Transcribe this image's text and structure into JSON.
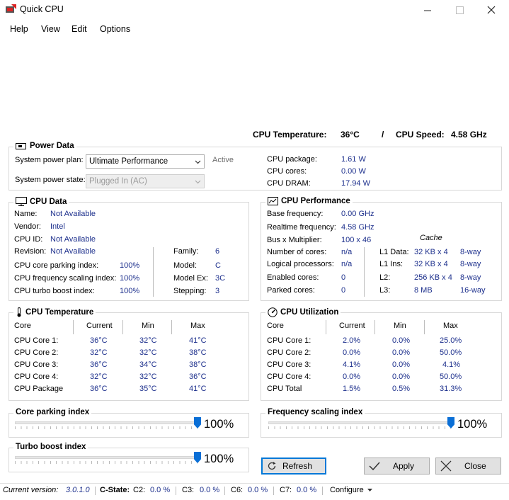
{
  "window": {
    "title": "Quick CPU"
  },
  "menu": [
    "Help",
    "View",
    "Edit",
    "Options"
  ],
  "header": {
    "temp_label": "CPU Temperature:",
    "temp_value": "36°C",
    "separator": "/",
    "speed_label": "CPU Speed:",
    "speed_value": "4.58 GHz"
  },
  "power": {
    "title": "Power Data",
    "plan_label": "System power plan:",
    "plan_value": "Ultimate Performance",
    "plan_status": "Active",
    "state_label": "System power state:",
    "state_value": "Plugged In (AC)",
    "rows": [
      {
        "label": "CPU package:",
        "value": "1.61 W"
      },
      {
        "label": "CPU cores:",
        "value": "0.00 W"
      },
      {
        "label": "CPU DRAM:",
        "value": "17.94 W"
      }
    ]
  },
  "cpu_data": {
    "title": "CPU Data",
    "name_label": "Name:",
    "name_value": "Not Available",
    "vendor_label": "Vendor:",
    "vendor_value": "Intel",
    "id_label": "CPU ID:",
    "id_value": "Not Available",
    "revision_label": "Revision:",
    "revision_value": "Not Available",
    "parking_label": "CPU core parking index:",
    "parking_value": "100%",
    "freq_label": "CPU frequency scaling index:",
    "freq_value": "100%",
    "turbo_label": "CPU turbo boost index:",
    "turbo_value": "100%",
    "family_label": "Family:",
    "family_value": "6",
    "model_label": "Model:",
    "model_value": "C",
    "modelex_label": "Model Ex:",
    "modelex_value": "3C",
    "stepping_label": "Stepping:",
    "stepping_value": "3"
  },
  "cpu_perf": {
    "title": "CPU Performance",
    "base_label": "Base frequency:",
    "base_value": "0.00 GHz",
    "realtime_label": "Realtime frequency:",
    "realtime_value": "4.58 GHz",
    "bus_label": "Bus x Multiplier:",
    "bus_value": "100 x 46",
    "cache_label": "Cache",
    "cores_label": "Number of cores:",
    "cores_value": "n/a",
    "logical_label": "Logical processors:",
    "logical_value": "n/a",
    "enabled_label": "Enabled cores:",
    "enabled_value": "0",
    "parked_label": "Parked cores:",
    "parked_value": "0",
    "cache": [
      {
        "label": "L1 Data:",
        "size": "32 KB x 4",
        "way": "8-way"
      },
      {
        "label": "L1 Ins:",
        "size": "32 KB x 4",
        "way": "8-way"
      },
      {
        "label": "L2:",
        "size": "256 KB x 4",
        "way": "8-way"
      },
      {
        "label": "L3:",
        "size": "8 MB",
        "way": "16-way"
      }
    ]
  },
  "cpu_temp": {
    "title": "CPU Temperature",
    "headers": [
      "Core",
      "Current",
      "Min",
      "Max"
    ],
    "rows": [
      [
        "CPU Core 1:",
        "36°C",
        "32°C",
        "41°C"
      ],
      [
        "CPU Core 2:",
        "32°C",
        "32°C",
        "38°C"
      ],
      [
        "CPU Core 3:",
        "36°C",
        "34°C",
        "38°C"
      ],
      [
        "CPU Core 4:",
        "32°C",
        "32°C",
        "36°C"
      ],
      [
        "CPU Package",
        "36°C",
        "35°C",
        "41°C"
      ]
    ]
  },
  "cpu_util": {
    "title": "CPU Utilization",
    "headers": [
      "Core",
      "Current",
      "Min",
      "Max"
    ],
    "rows": [
      [
        "CPU Core 1:",
        "2.0%",
        "0.0%",
        "25.0%"
      ],
      [
        "CPU Core 2:",
        "0.0%",
        "0.0%",
        "50.0%"
      ],
      [
        "CPU Core 3:",
        "4.1%",
        "0.0%",
        "4.1%"
      ],
      [
        "CPU Core 4:",
        "0.0%",
        "0.0%",
        "50.0%"
      ],
      [
        "CPU Total",
        "1.5%",
        "0.5%",
        "31.3%"
      ]
    ]
  },
  "sliders": {
    "parking": {
      "title": "Core parking index",
      "value": "100%",
      "fraction": 1.0
    },
    "frequency": {
      "title": "Frequency scaling index",
      "value": "100%",
      "fraction": 1.0
    },
    "turbo": {
      "title": "Turbo boost index",
      "value": "100%",
      "fraction": 1.0
    }
  },
  "buttons": {
    "refresh": "Refresh",
    "apply": "Apply",
    "close": "Close"
  },
  "status": {
    "version_label": "Current version:",
    "version_value": "3.0.1.0",
    "cstate_label": "C-State:",
    "c2_label": "C2:",
    "c2_value": "0.0 %",
    "c3_label": "C3:",
    "c3_value": "0.0 %",
    "c6_label": "C6:",
    "c6_value": "0.0 %",
    "c7_label": "C7:",
    "c7_value": "0.0 %",
    "configure": "Configure"
  },
  "colors": {
    "value_text": "#1c2f8c",
    "slider_thumb": "#0a6fd6",
    "focus_border": "#0078d7"
  }
}
